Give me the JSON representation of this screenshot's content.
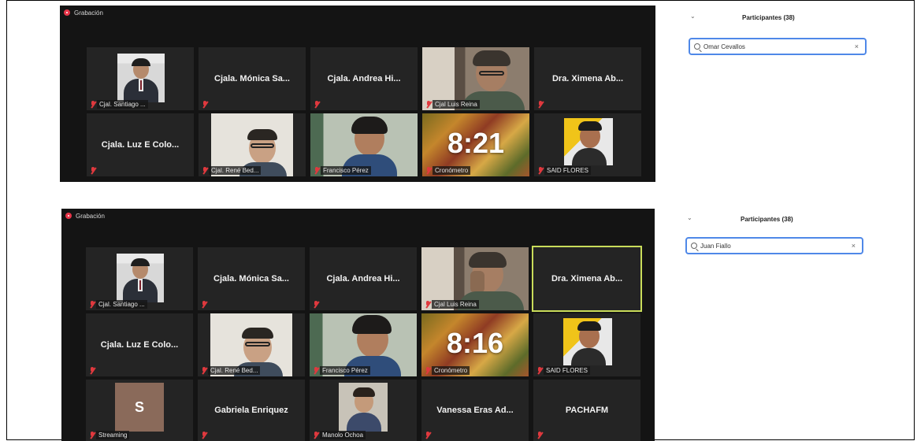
{
  "top": {
    "recording_label": "Grabación",
    "participants_title": "Participantes (38)",
    "search_value": "Omar Cevallos",
    "tiles": [
      {
        "name": "Cjal. Santiago ...",
        "kind": "photo"
      },
      {
        "name": "Cjala. Mónica Sa...",
        "kind": "text"
      },
      {
        "name": "Cjala. Andrea Hi...",
        "kind": "text"
      },
      {
        "name": "Cjal Luis Reina",
        "kind": "photo"
      },
      {
        "name": "Dra. Ximena Ab...",
        "kind": "text"
      },
      {
        "name": "Cjala. Luz E Colo...",
        "kind": "text"
      },
      {
        "name": "Cjal. René Bed...",
        "kind": "photo"
      },
      {
        "name": "Francisco Pérez",
        "kind": "photo"
      },
      {
        "name": "Cronómetro",
        "kind": "timer",
        "time": "8:21"
      },
      {
        "name": "SAID FLORES",
        "kind": "photo"
      }
    ]
  },
  "bottom": {
    "recording_label": "Grabación",
    "participants_title": "Participantes (38)",
    "search_value": "Juan Fiallo",
    "tiles": [
      {
        "name": "Cjal. Santiago ...",
        "kind": "photo"
      },
      {
        "name": "Cjala. Mónica Sa...",
        "kind": "text"
      },
      {
        "name": "Cjala. Andrea Hi...",
        "kind": "text"
      },
      {
        "name": "Cjal Luis Reina",
        "kind": "photo"
      },
      {
        "name": "Dra. Ximena Ab...",
        "kind": "text"
      },
      {
        "name": "Cjala. Luz E Colo...",
        "kind": "text"
      },
      {
        "name": "Cjal. René Bed...",
        "kind": "photo"
      },
      {
        "name": "Francisco Pérez",
        "kind": "photo"
      },
      {
        "name": "Cronómetro",
        "kind": "timer",
        "time": "8:16"
      },
      {
        "name": "SAID FLORES",
        "kind": "photo"
      },
      {
        "name": "Streaming",
        "kind": "avatar",
        "initial": "S"
      },
      {
        "name": "Gabriela Enriquez",
        "kind": "text"
      },
      {
        "name": "Manolo Ochoa",
        "kind": "photo"
      },
      {
        "name": "Vanessa Eras Ad...",
        "kind": "text"
      },
      {
        "name": "PACHAFM",
        "kind": "text"
      }
    ]
  }
}
